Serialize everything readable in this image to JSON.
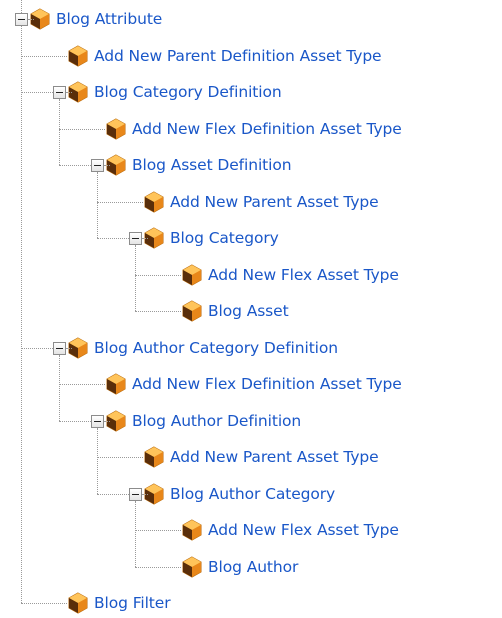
{
  "tree": {
    "label": "Blog Attribute",
    "children": [
      {
        "label": "Add New Parent Definition Asset Type"
      },
      {
        "label": "Blog Category Definition",
        "children": [
          {
            "label": "Add New Flex Definition Asset Type"
          },
          {
            "label": "Blog Asset Definition",
            "children": [
              {
                "label": "Add New Parent Asset Type"
              },
              {
                "label": "Blog Category",
                "children": [
                  {
                    "label": "Add New Flex Asset Type"
                  },
                  {
                    "label": "Blog Asset"
                  }
                ]
              }
            ]
          }
        ]
      },
      {
        "label": "Blog Author Category Definition",
        "children": [
          {
            "label": "Add New Flex Definition Asset Type"
          },
          {
            "label": "Blog Author Definition",
            "children": [
              {
                "label": "Add New Parent Asset Type"
              },
              {
                "label": "Blog Author Category",
                "children": [
                  {
                    "label": "Add New Flex Asset Type"
                  },
                  {
                    "label": "Blog Author"
                  }
                ]
              }
            ]
          }
        ]
      },
      {
        "label": "Blog Filter"
      }
    ]
  },
  "colors": {
    "link": "#1a57c8",
    "connector": "#9a9a9a",
    "icon_orange": "#f39a1e",
    "icon_dark": "#5a2e0a"
  },
  "icon": "orange-hexagon-asset-icon"
}
